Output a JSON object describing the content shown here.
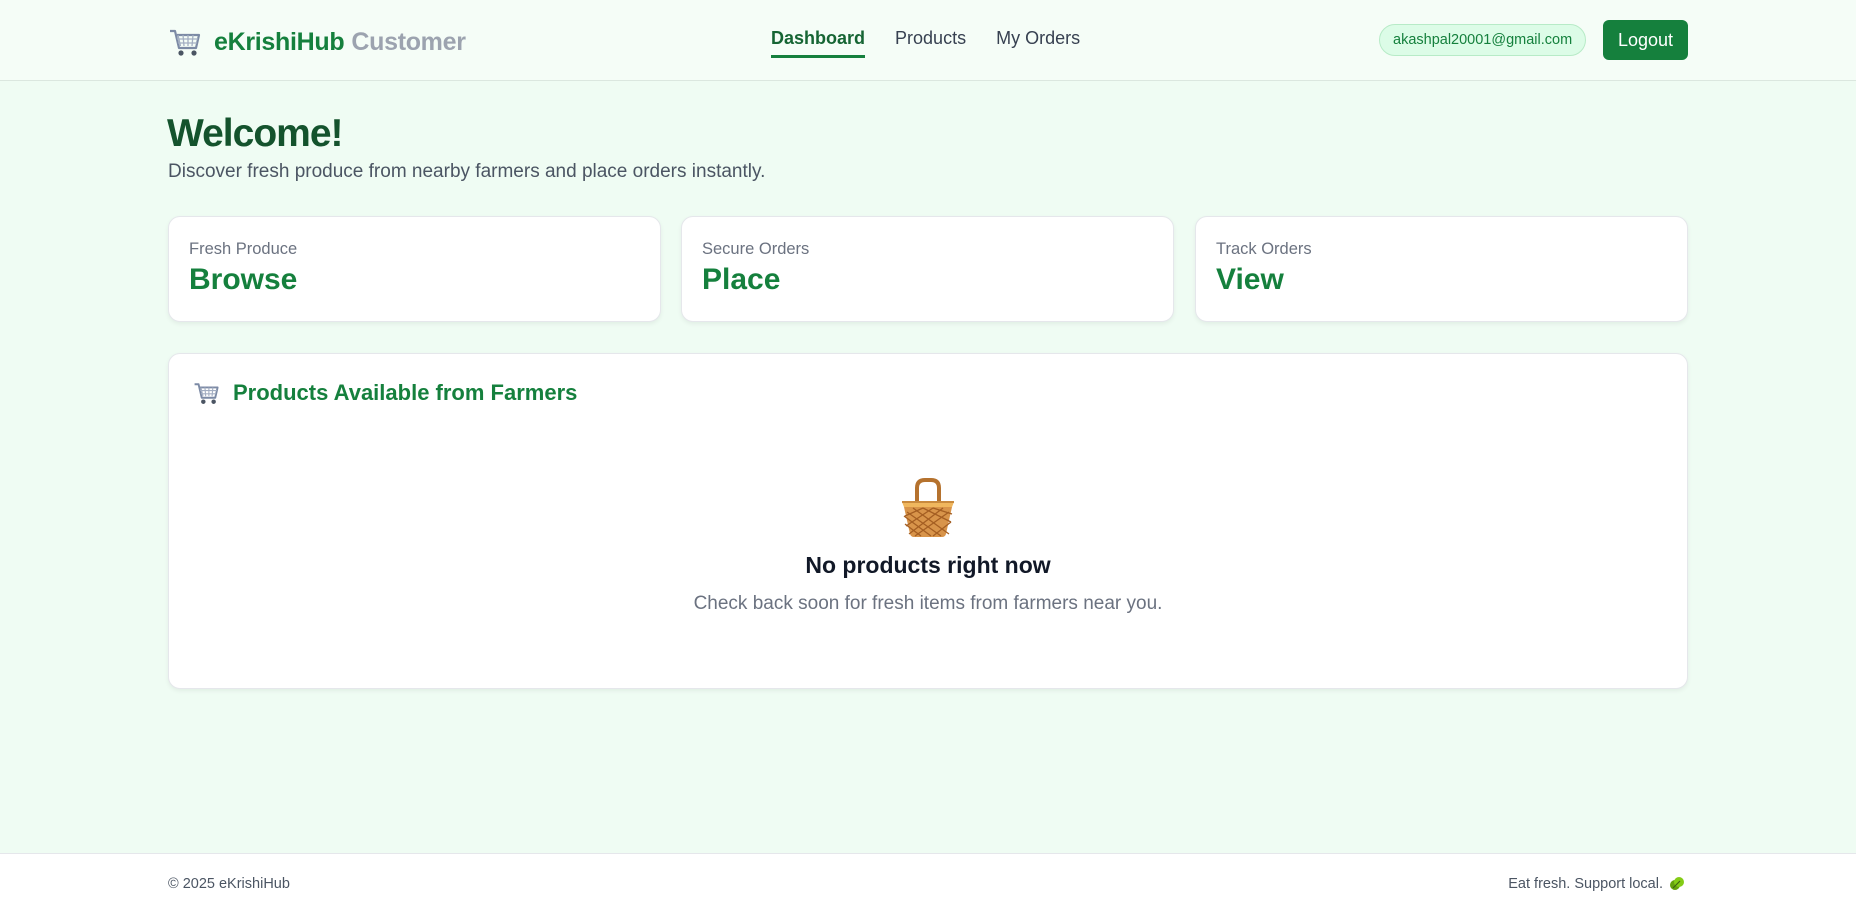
{
  "header": {
    "brand_name": "eKrishiHub",
    "brand_role": "Customer",
    "brand_icon": "shopping-cart-icon",
    "nav": [
      {
        "label": "Dashboard",
        "active": true
      },
      {
        "label": "Products",
        "active": false
      },
      {
        "label": "My Orders",
        "active": false
      }
    ],
    "user_email": "akashpal20001@gmail.com",
    "logout_label": "Logout"
  },
  "main": {
    "welcome_title": "Welcome!",
    "welcome_subtitle": "Discover fresh produce from nearby farmers and place orders instantly.",
    "cards": [
      {
        "label": "Fresh Produce",
        "value": "Browse"
      },
      {
        "label": "Secure Orders",
        "value": "Place"
      },
      {
        "label": "Track Orders",
        "value": "View"
      }
    ],
    "products_panel": {
      "title": "Products Available from Farmers",
      "icon": "shopping-cart-icon",
      "empty_icon": "basket-icon",
      "empty_title": "No products right now",
      "empty_hint": "Check back soon for fresh items from farmers near you."
    }
  },
  "footer": {
    "copyright": "© 2025 eKrishiHub",
    "tagline": "Eat fresh. Support local.",
    "tagline_icon": "leafy-green-icon"
  },
  "colors": {
    "brand_green": "#15803d",
    "page_bg": "#effcf3",
    "heading_dark_green": "#14532d",
    "muted_gray": "#9ca3af"
  }
}
